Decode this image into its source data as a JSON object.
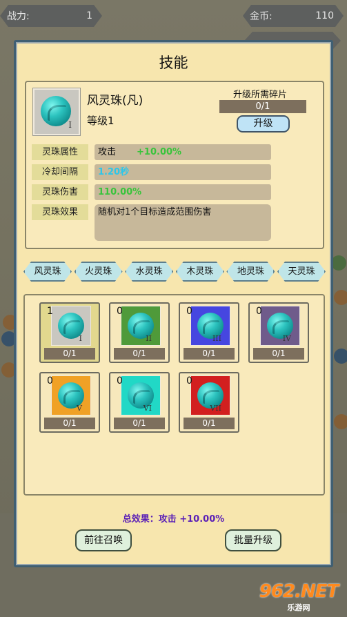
{
  "hud": {
    "power_label": "战力:",
    "power_value": "1",
    "gold_label": "金币:",
    "gold_value": "110"
  },
  "modal": {
    "title": "技能"
  },
  "skill": {
    "name": "风灵珠(凡)",
    "level": "等级1",
    "roman": "I",
    "fragment_label": "升级所需碎片",
    "fragment_progress": "0/1",
    "upgrade_label": "升级"
  },
  "attributes": [
    {
      "label": "灵珠属性",
      "value": "攻击",
      "highlight": "+10.00%"
    },
    {
      "label": "冷却间隔",
      "value": "",
      "highlight": "1.20秒"
    },
    {
      "label": "灵珠伤害",
      "value": "",
      "highlight": "110.00%"
    },
    {
      "label": "灵珠效果",
      "value": "随机对1个目标造成范围伤害",
      "highlight": ""
    }
  ],
  "tabs": [
    "风灵珠",
    "火灵珠",
    "水灵珠",
    "木灵珠",
    "地灵珠",
    "天灵珠"
  ],
  "cards": [
    {
      "count": "1",
      "roman": "I",
      "progress": "0/1",
      "color": "#c9c7c0"
    },
    {
      "count": "0",
      "roman": "II",
      "progress": "0/1",
      "color": "#4f9a3a"
    },
    {
      "count": "0",
      "roman": "III",
      "progress": "0/1",
      "color": "#4646e0"
    },
    {
      "count": "0",
      "roman": "IV",
      "progress": "0/1",
      "color": "#6f5b8b"
    },
    {
      "count": "0",
      "roman": "V",
      "progress": "0/1",
      "color": "#f0a126"
    },
    {
      "count": "0",
      "roman": "VI",
      "progress": "0/1",
      "color": "#21d8c6"
    },
    {
      "count": "0",
      "roman": "VII",
      "progress": "0/1",
      "color": "#d21f1f"
    }
  ],
  "total_effect": "总效果：攻击 +10.00%",
  "buttons": {
    "summon": "前往召唤",
    "batch_upgrade": "批量升级"
  },
  "watermark": {
    "logo": "962.NET",
    "sub": "乐游网"
  }
}
